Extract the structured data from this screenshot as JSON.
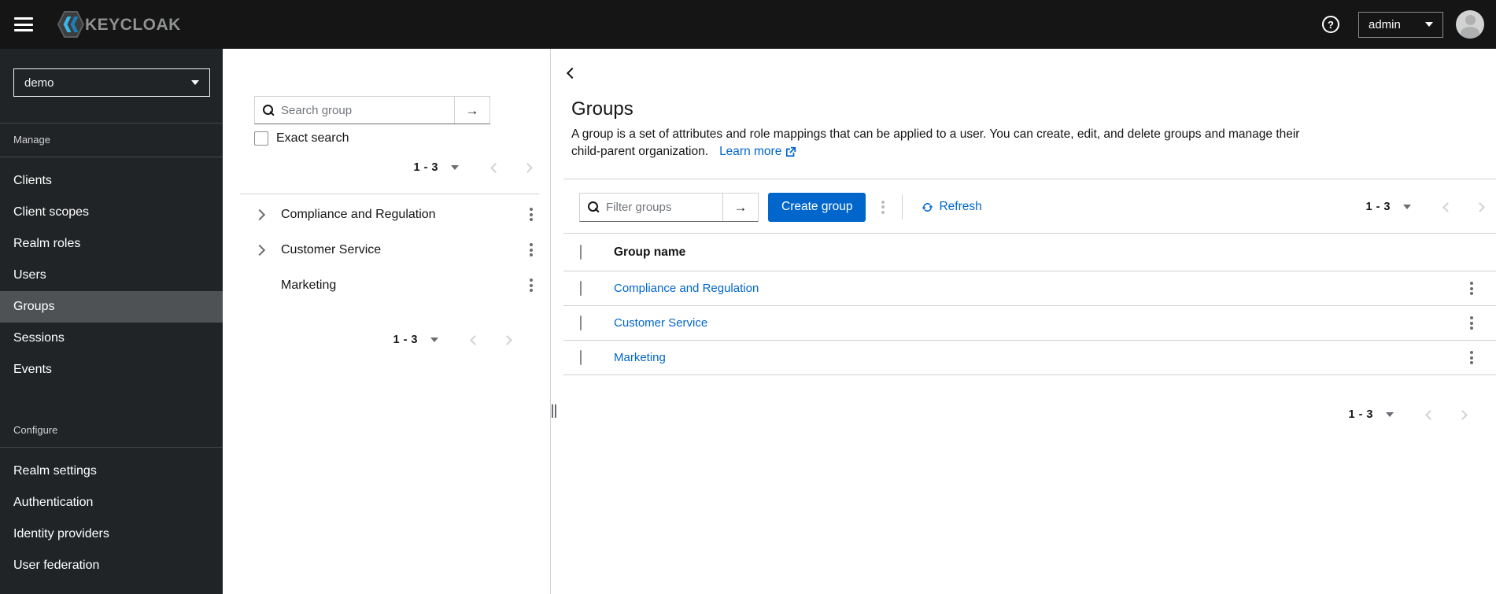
{
  "masthead": {
    "brand_text": "KEYCLOAK",
    "help_glyph": "?",
    "username": "admin"
  },
  "sidebar": {
    "realm_select": {
      "value": "demo"
    },
    "sections": [
      {
        "title": "Manage",
        "items": [
          {
            "label": "Clients"
          },
          {
            "label": "Client scopes"
          },
          {
            "label": "Realm roles"
          },
          {
            "label": "Users"
          },
          {
            "label": "Groups",
            "selected": true
          },
          {
            "label": "Sessions"
          },
          {
            "label": "Events"
          }
        ]
      },
      {
        "title": "Configure",
        "items": [
          {
            "label": "Realm settings"
          },
          {
            "label": "Authentication"
          },
          {
            "label": "Identity providers"
          },
          {
            "label": "User federation"
          }
        ]
      }
    ]
  },
  "tree_panel": {
    "search_placeholder": "Search group",
    "exact_search_label": "Exact search",
    "pagination_top_range": "1 - 3",
    "pagination_bottom_range": "1 - 3",
    "rows": [
      {
        "label": "Compliance and Regulation",
        "expandable": true
      },
      {
        "label": "Customer Service",
        "expandable": true
      },
      {
        "label": "Marketing",
        "expandable": false
      }
    ]
  },
  "main": {
    "title": "Groups",
    "description_line1": "A group is a set of attributes and role mappings that can be applied to a user. You can create, edit, and delete groups and manage their",
    "description_line2": "child-parent organization.",
    "learn_more_label": "Learn more",
    "toolbar": {
      "filter_placeholder": "Filter groups",
      "create_button_label": "Create group",
      "refresh_label": "Refresh",
      "pagination_range": "1 - 3"
    },
    "table": {
      "header": "Group name",
      "rows": [
        {
          "name": "Compliance and Regulation"
        },
        {
          "name": "Customer Service"
        },
        {
          "name": "Marketing"
        }
      ]
    },
    "pagination_bottom_range": "1 - 3"
  },
  "colors": {
    "primary": "#0066cc",
    "link": "#0066cc",
    "masthead_bg": "#151515",
    "sidebar_bg": "#212427",
    "sidebar_selected_bg": "#4f5255",
    "border_light": "#d2d2d2",
    "icon_gray": "#6a6e73"
  }
}
